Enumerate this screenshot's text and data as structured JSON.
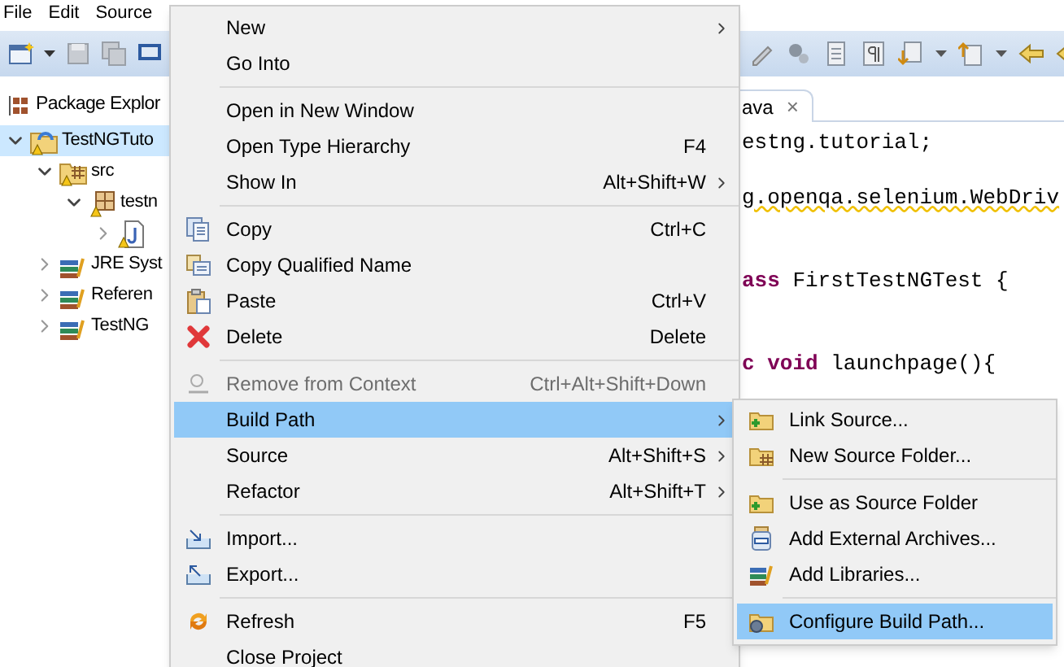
{
  "menubar": [
    {
      "label": "File"
    },
    {
      "label": "Edit"
    },
    {
      "label": "Source"
    }
  ],
  "package_explorer": {
    "title": "Package Explor",
    "tree": [
      {
        "label": "TestNGTuto",
        "kind": "project",
        "expanded": true,
        "selected": true,
        "children": [
          {
            "label": "src",
            "kind": "source-folder",
            "expanded": true,
            "selected": false,
            "children": [
              {
                "label": "testn",
                "kind": "package",
                "expanded": true,
                "selected": false,
                "children": [
                  {
                    "kind": "java-file",
                    "expanded": false,
                    "selected": false
                  }
                ]
              }
            ]
          },
          {
            "label": "JRE Syst",
            "kind": "library",
            "expanded": false,
            "selected": false
          },
          {
            "label": "Referen",
            "kind": "library",
            "expanded": false,
            "selected": false
          },
          {
            "label": "TestNG",
            "kind": "library",
            "expanded": false,
            "selected": false
          }
        ]
      }
    ]
  },
  "editor": {
    "tab": "ava",
    "close": "×",
    "lines": [
      {
        "kind": "code",
        "segments": [
          {
            "text": "estng.tutorial;",
            "kind": "plain"
          }
        ]
      },
      {
        "kind": "blank"
      },
      {
        "kind": "code",
        "segments": [
          {
            "text": "g.openqa.selenium.WebDriv",
            "kind": "warning"
          }
        ]
      },
      {
        "kind": "blank"
      },
      {
        "kind": "blank"
      },
      {
        "kind": "code",
        "segments": [
          {
            "text": "ass",
            "kind": "keyword"
          },
          {
            "text": " FirstTestNGTest {",
            "kind": "plain"
          }
        ]
      },
      {
        "kind": "blank"
      },
      {
        "kind": "blank"
      },
      {
        "kind": "code",
        "segments": [
          {
            "text": "c void",
            "kind": "keyword"
          },
          {
            "text": " launchpage(){",
            "kind": "plain"
          }
        ]
      }
    ]
  },
  "context_menu": {
    "items": [
      {
        "kind": "item",
        "label": "New",
        "submenu": true,
        "selected": false,
        "disabled": false
      },
      {
        "kind": "item",
        "label": "Go Into",
        "selected": false,
        "disabled": false
      },
      {
        "kind": "separator"
      },
      {
        "kind": "item",
        "label": "Open in New Window",
        "selected": false,
        "disabled": false
      },
      {
        "kind": "item",
        "label": "Open Type Hierarchy",
        "shortcut": "F4",
        "selected": false,
        "disabled": false
      },
      {
        "kind": "item",
        "label": "Show In",
        "shortcut": "Alt+Shift+W",
        "submenu": true,
        "selected": false,
        "disabled": false
      },
      {
        "kind": "separator"
      },
      {
        "kind": "item",
        "label": "Copy",
        "shortcut": "Ctrl+C",
        "selected": false,
        "disabled": false
      },
      {
        "kind": "item",
        "label": "Copy Qualified Name",
        "selected": false,
        "disabled": false
      },
      {
        "kind": "item",
        "label": "Paste",
        "shortcut": "Ctrl+V",
        "selected": false,
        "disabled": false
      },
      {
        "kind": "item",
        "label": "Delete",
        "shortcut": "Delete",
        "selected": false,
        "disabled": false
      },
      {
        "kind": "separator"
      },
      {
        "kind": "item",
        "label": "Remove from Context",
        "shortcut": "Ctrl+Alt+Shift+Down",
        "selected": false,
        "disabled": true
      },
      {
        "kind": "item",
        "label": "Build Path",
        "submenu": true,
        "selected": true,
        "disabled": false
      },
      {
        "kind": "item",
        "label": "Source",
        "shortcut": "Alt+Shift+S",
        "submenu": true,
        "selected": false,
        "disabled": false
      },
      {
        "kind": "item",
        "label": "Refactor",
        "shortcut": "Alt+Shift+T",
        "submenu": true,
        "selected": false,
        "disabled": false
      },
      {
        "kind": "separator"
      },
      {
        "kind": "item",
        "label": "Import...",
        "selected": false,
        "disabled": false
      },
      {
        "kind": "item",
        "label": "Export...",
        "selected": false,
        "disabled": false
      },
      {
        "kind": "separator"
      },
      {
        "kind": "item",
        "label": "Refresh",
        "shortcut": "F5",
        "selected": false,
        "disabled": false
      },
      {
        "kind": "item",
        "label": "Close Project",
        "selected": false,
        "disabled": false
      }
    ]
  },
  "submenu": {
    "items": [
      {
        "kind": "item",
        "label": "Link Source...",
        "selected": false
      },
      {
        "kind": "item",
        "label": "New Source Folder...",
        "selected": false
      },
      {
        "kind": "separator"
      },
      {
        "kind": "item",
        "label": "Use as Source Folder",
        "selected": false
      },
      {
        "kind": "item",
        "label": "Add External Archives...",
        "selected": false
      },
      {
        "kind": "item",
        "label": "Add Libraries...",
        "selected": false
      },
      {
        "kind": "separator"
      },
      {
        "kind": "item",
        "label": "Configure Build Path...",
        "selected": true
      }
    ]
  }
}
